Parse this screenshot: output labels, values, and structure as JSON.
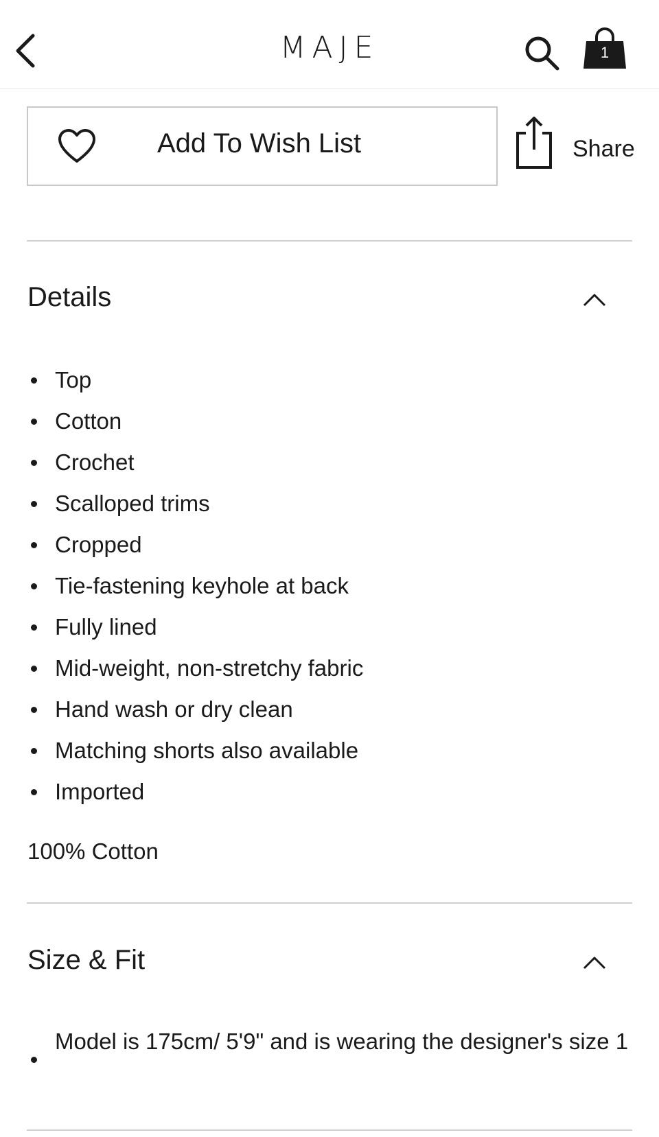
{
  "header": {
    "brand": "MAJE",
    "bag_count": "1"
  },
  "actions": {
    "wish_label": "Add To Wish List",
    "share_label": "Share"
  },
  "details": {
    "title": "Details",
    "items": [
      "Top",
      "Cotton",
      "Crochet",
      "Scalloped trims",
      "Cropped",
      "Tie-fastening keyhole at back",
      "Fully lined",
      "Mid-weight, non-stretchy fabric",
      "Hand wash or dry clean",
      "Matching shorts also available",
      "Imported"
    ],
    "composition": "100% Cotton"
  },
  "size_fit": {
    "title": "Size & Fit",
    "items": [
      "Model is 175cm/ 5'9\" and is wearing the designer's size 1"
    ]
  },
  "icons": {
    "back": "chevron-left-icon",
    "search": "search-icon",
    "bag": "shopping-bag-icon",
    "heart": "heart-icon",
    "share": "share-icon",
    "collapse": "chevron-up-icon"
  }
}
